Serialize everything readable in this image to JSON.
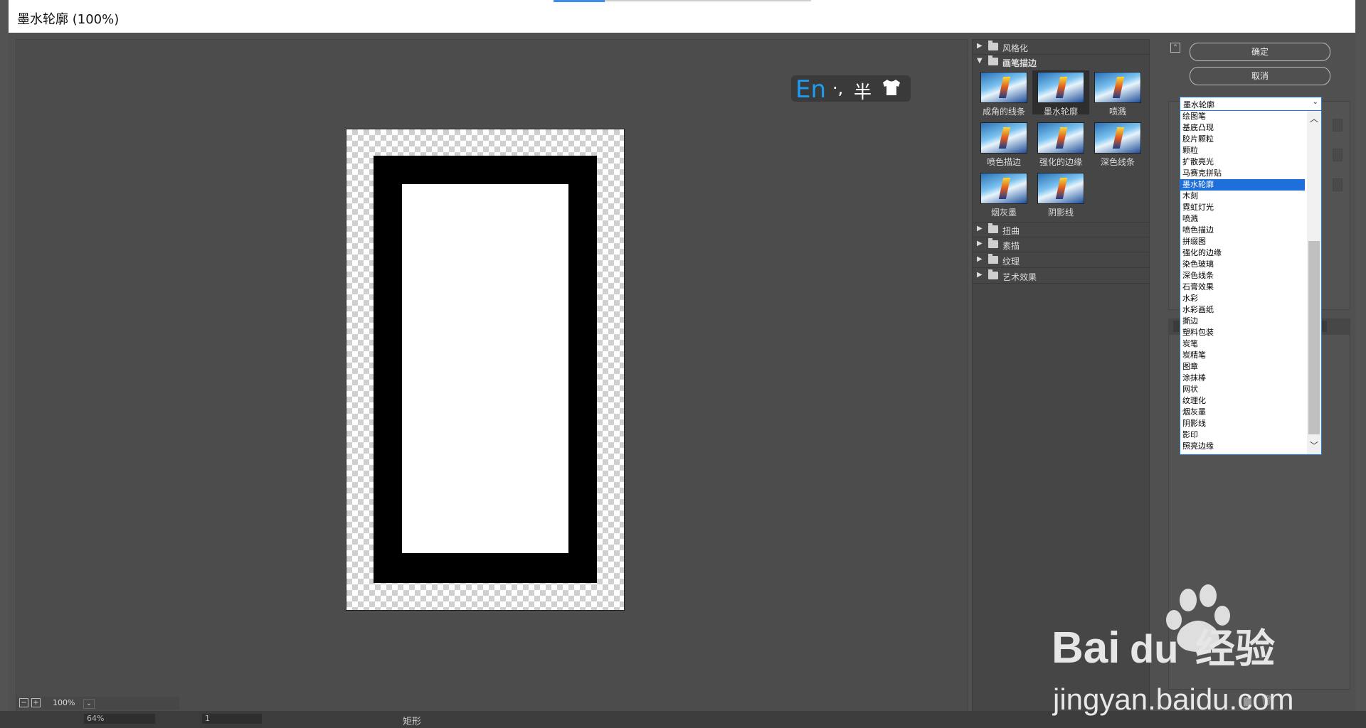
{
  "window": {
    "title": "墨水轮廓 (100%)"
  },
  "preview": {
    "zoom": "100%",
    "zoom_out_icon": "minus-box-icon",
    "zoom_in_icon": "plus-box-icon"
  },
  "ime": {
    "mode": "En",
    "punct": "·,",
    "width": "半",
    "skin_icon": "tshirt-icon"
  },
  "gallery": {
    "categories_top": [
      {
        "label": "风格化",
        "expanded": false
      },
      {
        "label": "画笔描边",
        "expanded": true
      }
    ],
    "thumbs": [
      {
        "label": "成角的线条",
        "selected": false
      },
      {
        "label": "墨水轮廓",
        "selected": true
      },
      {
        "label": "喷溅",
        "selected": false
      },
      {
        "label": "喷色描边",
        "selected": false
      },
      {
        "label": "强化的边缘",
        "selected": false
      },
      {
        "label": "深色线条",
        "selected": false
      },
      {
        "label": "烟灰墨",
        "selected": false
      },
      {
        "label": "阴影线",
        "selected": false
      }
    ],
    "categories_bottom": [
      {
        "label": "扭曲"
      },
      {
        "label": "素描"
      },
      {
        "label": "纹理"
      },
      {
        "label": "艺术效果"
      }
    ]
  },
  "buttons": {
    "ok": "确定",
    "cancel": "取消",
    "collapse_icon": "collapse-up-icon"
  },
  "filter_select": {
    "value": "墨水轮廓",
    "options": [
      "绘图笔",
      "基底凸现",
      "胶片颗粒",
      "颗粒",
      "扩散亮光",
      "马赛克拼贴",
      "墨水轮廓",
      "木刻",
      "霓虹灯光",
      "喷溅",
      "喷色描边",
      "拼缀图",
      "强化的边缘",
      "染色玻璃",
      "深色线条",
      "石膏效果",
      "水彩",
      "水彩画纸",
      "撕边",
      "塑料包装",
      "炭笔",
      "炭精笔",
      "图章",
      "涂抹棒",
      "网状",
      "纹理化",
      "烟灰墨",
      "阴影线",
      "影印",
      "照亮边缘"
    ],
    "selected_index": 6
  },
  "layer_icons": {
    "new_layer": "new-effect-layer-icon",
    "delete": "trash-icon"
  },
  "bottom_bar": {
    "zoom": "64%",
    "page": "1",
    "tool": "矩形"
  },
  "watermark": {
    "brand": "Bai du 经验",
    "url": "jingyan.baidu.com"
  }
}
